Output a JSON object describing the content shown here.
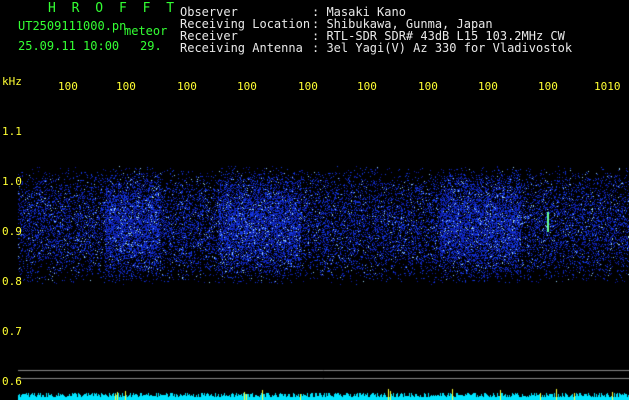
{
  "header": {
    "logo": "H R O F F T",
    "filename": "UT2509111000.pn",
    "mode": "meteor",
    "datetime": "25.09.11 10:00",
    "count": "29.",
    "observer_label": "Observer",
    "observer_value": ": Masaki Kano",
    "location_label": "Receiving Location",
    "location_value": ": Shibukawa, Gunma, Japan",
    "receiver_label": "Receiver",
    "receiver_value": ": RTL-SDR SDR# 43dB L15 103.2MHz CW",
    "antenna_label": "Receiving Antenna",
    "antenna_value": ": 3el Yagi(V) Az 330 for Vladivostok"
  },
  "axis": {
    "unit": "kHz",
    "y_ticks": [
      "1.1",
      "1.0",
      "0.9",
      "0.8",
      "0.7",
      "0.6"
    ],
    "x_ticks": [
      "100",
      "100",
      "100",
      "100",
      "100",
      "100",
      "100",
      "100",
      "100",
      "1010"
    ]
  },
  "colors": {
    "background": "#000000",
    "text_green": "#33ff33",
    "text_white": "#e8e8e8",
    "text_yellow": "#ffff33",
    "noise_band": "#1a2fd0",
    "baseline": "#00e5ff"
  }
}
